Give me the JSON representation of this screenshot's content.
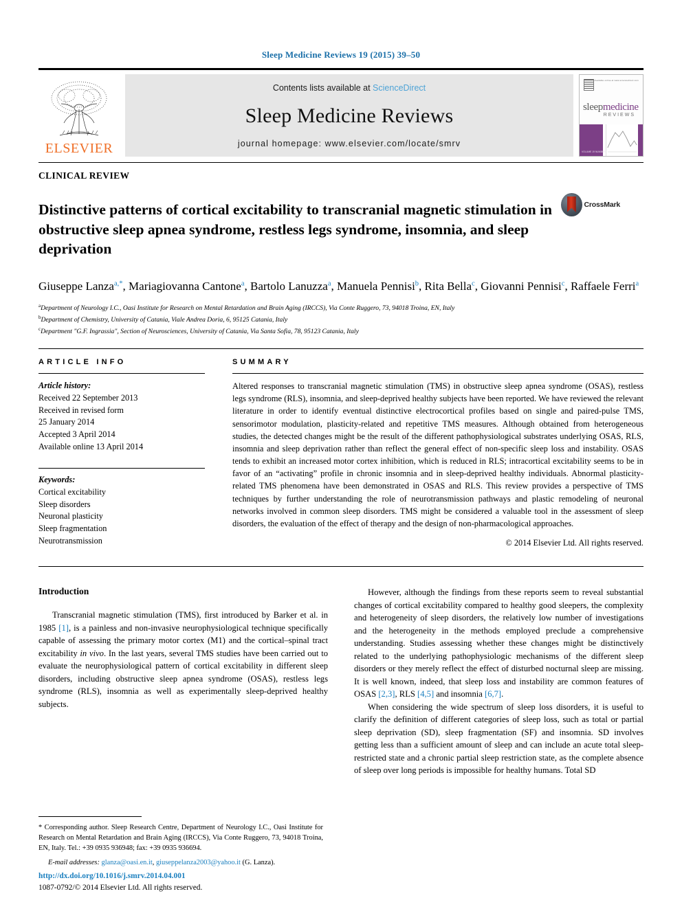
{
  "running_head": "Sleep Medicine Reviews 19 (2015) 39–50",
  "masthead": {
    "contents_prefix": "Contents lists available at ",
    "sciencedirect": "ScienceDirect",
    "journal_title": "Sleep Medicine Reviews",
    "homepage": "journal homepage: www.elsevier.com/locate/smrv",
    "publisher": "ELSEVIER",
    "sciencedirect_color": "#4ea3d6",
    "publisher_color": "#ef6f27"
  },
  "cover": {
    "word1": "sleep",
    "word2": "medicine",
    "subtitle": "REVIEWS",
    "masthead_tiny": "Available online at www.sciencedirect.com",
    "issue_tiny": "VOLUME 19\nNUMBER 1\nFEBRUARY 2015"
  },
  "article": {
    "kicker": "CLINICAL REVIEW",
    "title": "Distinctive patterns of cortical excitability to transcranial magnetic stimulation in obstructive sleep apnea syndrome, restless legs syndrome, insomnia, and sleep deprivation",
    "crossmark_label": "CrossMark",
    "authors": [
      {
        "name": "Giuseppe Lanza",
        "sup": "a,*"
      },
      {
        "name": "Mariagiovanna Cantone",
        "sup": "a"
      },
      {
        "name": "Bartolo Lanuzza",
        "sup": "a"
      },
      {
        "name": "Manuela Pennisi",
        "sup": "b"
      },
      {
        "name": "Rita Bella",
        "sup": "c"
      },
      {
        "name": "Giovanni Pennisi",
        "sup": "c"
      },
      {
        "name": "Raffaele Ferri",
        "sup": "a"
      }
    ],
    "affiliations": [
      {
        "mark": "a",
        "text": "Department of Neurology I.C., Oasi Institute for Research on Mental Retardation and Brain Aging (IRCCS), Via Conte Ruggero, 73, 94018 Troina, EN, Italy"
      },
      {
        "mark": "b",
        "text": "Department of Chemistry, University of Catania, Viale Andrea Doria, 6, 95125 Catania, Italy"
      },
      {
        "mark": "c",
        "text": "Department \"G.F. Ingrassia\", Section of Neurosciences, University of Catania, Via Santa Sofia, 78, 95123 Catania, Italy"
      }
    ]
  },
  "article_info": {
    "label": "ARTICLE INFO",
    "history_label": "Article history:",
    "history": [
      "Received 22 September 2013",
      "Received in revised form",
      "25 January 2014",
      "Accepted 3 April 2014",
      "Available online 13 April 2014"
    ],
    "keywords_label": "Keywords:",
    "keywords": [
      "Cortical excitability",
      "Sleep disorders",
      "Neuronal plasticity",
      "Sleep fragmentation",
      "Neurotransmission"
    ]
  },
  "summary": {
    "label": "SUMMARY",
    "text": "Altered responses to transcranial magnetic stimulation (TMS) in obstructive sleep apnea syndrome (OSAS), restless legs syndrome (RLS), insomnia, and sleep-deprived healthy subjects have been reported. We have reviewed the relevant literature in order to identify eventual distinctive electrocortical profiles based on single and paired-pulse TMS, sensorimotor modulation, plasticity-related and repetitive TMS measures. Although obtained from heterogeneous studies, the detected changes might be the result of the different pathophysiological substrates underlying OSAS, RLS, insomnia and sleep deprivation rather than reflect the general effect of non-specific sleep loss and instability. OSAS tends to exhibit an increased motor cortex inhibition, which is reduced in RLS; intracortical excitability seems to be in favor of an “activating” profile in chronic insomnia and in sleep-deprived healthy individuals. Abnormal plasticity-related TMS phenomena have been demonstrated in OSAS and RLS. This review provides a perspective of TMS techniques by further understanding the role of neurotransmission pathways and plastic remodeling of neuronal networks involved in common sleep disorders. TMS might be considered a valuable tool in the assessment of sleep disorders, the evaluation of the effect of therapy and the design of non-pharmacological approaches.",
    "copyright": "© 2014 Elsevier Ltd. All rights reserved."
  },
  "body": {
    "intro_heading": "Introduction",
    "left_p1_a": "Transcranial magnetic stimulation (TMS), first introduced by Barker et al. in 1985 ",
    "left_p1_ref": "[1]",
    "left_p1_b": ", is a painless and non-invasive neurophysiological technique specifically capable of assessing the primary motor cortex (M1) and the cortical–spinal tract excitability ",
    "left_p1_italic": "in vivo",
    "left_p1_c": ". In the last years, several TMS studies have been carried out to evaluate the neurophysiological pattern of cortical excitability in different sleep disorders, including obstructive sleep apnea syndrome (OSAS), restless legs syndrome (RLS), insomnia as well as experimentally sleep-deprived healthy subjects.",
    "right_p1_a": "However, although the findings from these reports seem to reveal substantial changes of cortical excitability compared to healthy good sleepers, the complexity and heterogeneity of sleep disorders, the relatively low number of investigations and the heterogeneity in the methods employed preclude a comprehensive understanding. Studies assessing whether these changes might be distinctively related to the underlying pathophysiologic mechanisms of the different sleep disorders or they merely reflect the effect of disturbed nocturnal sleep are missing. It is well known, indeed, that sleep loss and instability are common features of OSAS ",
    "right_p1_ref1": "[2,3]",
    "right_p1_b": ", RLS ",
    "right_p1_ref2": "[4,5]",
    "right_p1_c": " and insomnia ",
    "right_p1_ref3": "[6,7]",
    "right_p1_d": ".",
    "right_p2": "When considering the wide spectrum of sleep loss disorders, it is useful to clarify the definition of different categories of sleep loss, such as total or partial sleep deprivation (SD), sleep fragmentation (SF) and insomnia. SD involves getting less than a sufficient amount of sleep and can include an acute total sleep-restricted state and a chronic partial sleep restriction state, as the complete absence of sleep over long periods is impossible for healthy humans. Total SD"
  },
  "footnotes": {
    "corresponding": "* Corresponding author. Sleep Research Centre, Department of Neurology I.C., Oasi Institute for Research on Mental Retardation and Brain Aging (IRCCS), Via Conte Ruggero, 73, 94018 Troina, EN, Italy. Tel.: +39 0935 936948; fax: +39 0935 936694.",
    "email_label": "E-mail addresses:",
    "email1": "glanza@oasi.en.it",
    "email2": "giuseppelanza2003@yahoo.it",
    "email_suffix": "(G. Lanza).",
    "doi": "http://dx.doi.org/10.1016/j.smrv.2014.04.001",
    "issn_line": "1087-0792/© 2014 Elsevier Ltd. All rights reserved."
  }
}
